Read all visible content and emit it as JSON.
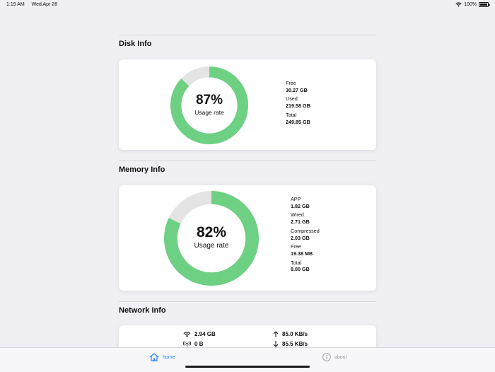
{
  "status_bar": {
    "time": "1:19 AM",
    "date": "Wed Apr 28",
    "battery": "100%"
  },
  "disk": {
    "title": "Disk Info",
    "usage_percent": 87,
    "percent_text": "87%",
    "usage_label": "Usage rate",
    "stats": [
      {
        "label": "Free",
        "value": "30.27 GB"
      },
      {
        "label": "Used",
        "value": "219.58 GB"
      },
      {
        "label": "Total",
        "value": "249.85 GB"
      }
    ]
  },
  "memory": {
    "title": "Memory Info",
    "usage_percent": 82,
    "percent_text": "82%",
    "usage_label": "Usage rate",
    "stats": [
      {
        "label": "APP",
        "value": "1.82 GB"
      },
      {
        "label": "Wired",
        "value": "2.71 GB"
      },
      {
        "label": "Compressed",
        "value": "2.03 GB"
      },
      {
        "label": "Free",
        "value": "19.38 MB"
      },
      {
        "label": "Total",
        "value": "8.00 GB"
      }
    ]
  },
  "network": {
    "title": "Network Info",
    "wifi_total": "2.94 GB",
    "cellular_total": "0 B",
    "upload_rate": "85.0 KB/s",
    "download_rate": "85.5 KB/s"
  },
  "tab_bar": {
    "home_label": "home",
    "about_label": "about",
    "active": "home"
  },
  "colors": {
    "ring_fill": "#6dd083",
    "ring_track": "#e4e4e4",
    "active_tab": "#1a82fb",
    "inactive_tab": "#9a9a9e"
  }
}
